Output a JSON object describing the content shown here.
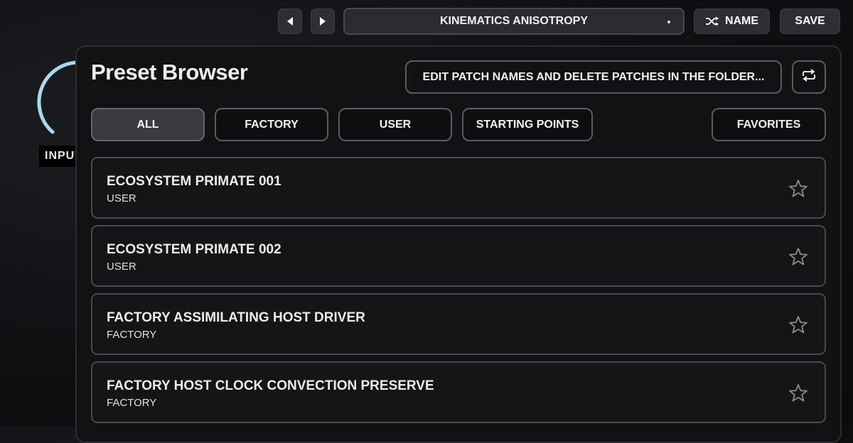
{
  "background": {
    "input_label": "INPUT"
  },
  "topbar": {
    "prev_icon": "triangle-left-icon",
    "next_icon": "triangle-right-icon",
    "preset_name": "KINEMATICS ANISOTROPY",
    "name_label": "NAME",
    "name_icon": "shuffle-icon",
    "save_label": "SAVE"
  },
  "browser": {
    "title": "Preset Browser",
    "edit_label": "EDIT PATCH NAMES AND DELETE PATCHES IN THE FOLDER...",
    "refresh_icon": "refresh-icon",
    "tabs": [
      {
        "label": "ALL",
        "active": true
      },
      {
        "label": "FACTORY",
        "active": false
      },
      {
        "label": "USER",
        "active": false
      },
      {
        "label": "STARTING POINTS",
        "active": false
      },
      {
        "label": "FAVORITES",
        "active": false
      }
    ],
    "presets": [
      {
        "name": "ECOSYSTEM PRIMATE 001",
        "category": "USER"
      },
      {
        "name": "ECOSYSTEM PRIMATE 002",
        "category": "USER"
      },
      {
        "name": "FACTORY ASSIMILATING HOST DRIVER",
        "category": "FACTORY"
      },
      {
        "name": "FACTORY HOST CLOCK CONVECTION PRESERVE",
        "category": "FACTORY"
      }
    ]
  },
  "colors": {
    "background": "#0f1012",
    "panel": "#111214",
    "border": "#5b5c61",
    "knob_arc": "#a8d8f0"
  }
}
